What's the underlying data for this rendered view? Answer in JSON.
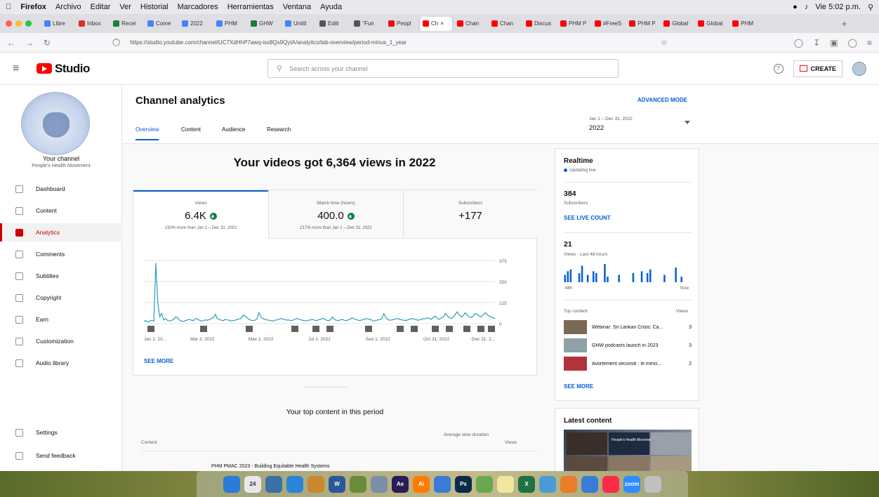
{
  "menubar": {
    "app": "Firefox",
    "items": [
      "Archivo",
      "Editar",
      "Ver",
      "Historial",
      "Marcadores",
      "Herramientas",
      "Ventana",
      "Ayuda"
    ],
    "clock": "Vie 5:02 p.m."
  },
  "browser": {
    "tabs": [
      {
        "label": "Libre",
        "color": "#4285f4"
      },
      {
        "label": "Inbox",
        "color": "#d93025"
      },
      {
        "label": "Recei",
        "color": "#188038"
      },
      {
        "label": "Come",
        "color": "#4285f4"
      },
      {
        "label": "2022",
        "color": "#4285f4"
      },
      {
        "label": "PHM",
        "color": "#4285f4"
      },
      {
        "label": "GHW",
        "color": "#188038"
      },
      {
        "label": "Untitl",
        "color": "#4285f4"
      },
      {
        "label": "Editi",
        "color": "#555555"
      },
      {
        "label": "\"Fun",
        "color": "#555555"
      },
      {
        "label": "Peopl",
        "color": "#ff0000"
      },
      {
        "label": "Ch",
        "color": "#ff0000",
        "active": true
      },
      {
        "label": "Chan",
        "color": "#ff0000"
      },
      {
        "label": "Chan",
        "color": "#ff0000"
      },
      {
        "label": "Discus",
        "color": "#ff0000"
      },
      {
        "label": "PHM P",
        "color": "#ff0000"
      },
      {
        "label": "#FreeS",
        "color": "#ff0000"
      },
      {
        "label": "PHM P",
        "color": "#ff0000"
      },
      {
        "label": "Global",
        "color": "#ff0000"
      },
      {
        "label": "Global",
        "color": "#ff0000"
      },
      {
        "label": "PHM",
        "color": "#ff0000"
      }
    ],
    "url": "https://studio.youtube.com/channel/UC7XdHhP7awq-isx8Qs9QytA/analytics/tab-overview/period-minus_1_year"
  },
  "studio": {
    "logo": "Studio",
    "search_placeholder": "Search across your channel",
    "create_label": "CREATE",
    "help_label": "?"
  },
  "sidebar": {
    "your_channel": "Your channel",
    "channel_name": "People's Health Movement",
    "items": [
      {
        "label": "Dashboard"
      },
      {
        "label": "Content"
      },
      {
        "label": "Analytics",
        "active": true
      },
      {
        "label": "Comments"
      },
      {
        "label": "Subtitles"
      },
      {
        "label": "Copyright"
      },
      {
        "label": "Earn"
      },
      {
        "label": "Customization"
      },
      {
        "label": "Audio library"
      }
    ],
    "bottom": [
      {
        "label": "Settings"
      },
      {
        "label": "Send feedback"
      }
    ]
  },
  "header": {
    "title": "Channel analytics",
    "advanced_mode": "ADVANCED MODE",
    "date_range": "Jan 1 – Dec 31, 2022",
    "date_year": "2022",
    "tabs": [
      "Overview",
      "Content",
      "Audience",
      "Research"
    ]
  },
  "overview": {
    "headline": "Your videos got 6,364 views in 2022",
    "metrics": [
      {
        "label": "Views",
        "value": "6.4K",
        "sub": "150% more than Jan 1 – Dec 31, 2021",
        "up": true
      },
      {
        "label": "Watch time (hours)",
        "value": "400.0",
        "sub": "217% more than Jan 1 – Dec 31, 2021",
        "up": true
      },
      {
        "label": "Subscribers",
        "value": "+177",
        "sub": "",
        "up": false
      }
    ],
    "see_more": "SEE MORE",
    "top_content_title": "Your top content in this period",
    "top_content_cols": {
      "content": "Content",
      "avg": "Average view duration",
      "views": "Views"
    },
    "top_content_first": "PHM PMAC 2023 - Building Equitable Health Systems"
  },
  "chart_data": {
    "type": "line",
    "x_ticks": [
      "Jan 1, 20...",
      "Mar 3, 2022",
      "May 2, 2022",
      "Jul 2, 2022",
      "Sep 1, 2022",
      "Oct 31, 2022",
      "Dec 31, 2..."
    ],
    "y_ticks": [
      "375",
      "250",
      "125",
      "0"
    ],
    "ylim": [
      0,
      375
    ],
    "color": "#2a9cbf",
    "series": [
      {
        "values": [
          12,
          18,
          10,
          15,
          20,
          14,
          360,
          120,
          40,
          60,
          22,
          30,
          18,
          15,
          20,
          25,
          40,
          35,
          20,
          15,
          12,
          18,
          22,
          25,
          20,
          18,
          30,
          28,
          20,
          15,
          18,
          22,
          20,
          24,
          30,
          35,
          55,
          30,
          25,
          20,
          18,
          25,
          22,
          20,
          15,
          18,
          20,
          25,
          28,
          30,
          50,
          45,
          35,
          25,
          20,
          18,
          20,
          28,
          65,
          40,
          30,
          25,
          22,
          20,
          18,
          15,
          20,
          22,
          25,
          30,
          28,
          25,
          20,
          22,
          18,
          20,
          25,
          30,
          28,
          22,
          20,
          18,
          15,
          20,
          22,
          25,
          20,
          18,
          22,
          25,
          30,
          28,
          20,
          18,
          22,
          40,
          25,
          20,
          18,
          22,
          25,
          20,
          18,
          22,
          25,
          35,
          28,
          25,
          20,
          18,
          22,
          25,
          30,
          28,
          25,
          20,
          15,
          18,
          22,
          25,
          30,
          60,
          35,
          25,
          20,
          22,
          25,
          28,
          30,
          25,
          22,
          20,
          18,
          22,
          25,
          30,
          28,
          25,
          20,
          22,
          25,
          30,
          28,
          35,
          30,
          25,
          40,
          45,
          30,
          25,
          35,
          40,
          60,
          45,
          35,
          30,
          40,
          55,
          70,
          50,
          40,
          45,
          65,
          50,
          40,
          35,
          45,
          60,
          55,
          45,
          40,
          50,
          65,
          55,
          45,
          40,
          35,
          30
        ]
      }
    ],
    "markers": [
      "04",
      "",
      "",
      "",
      "",
      "04",
      "",
      "",
      "",
      "",
      "",
      "",
      "",
      "",
      ""
    ]
  },
  "realtime": {
    "title": "Realtime",
    "live": "Updating live",
    "subs_value": "384",
    "subs_label": "Subscribers",
    "see_live": "SEE LIVE COUNT",
    "views_value": "21",
    "views_label": "Views · Last 48 hours",
    "axis_left": "-48h",
    "axis_right": "Now",
    "bars": [
      0.4,
      0.6,
      0.7,
      0,
      0,
      0.5,
      0.9,
      0,
      0.4,
      0,
      0.6,
      0.5,
      0,
      0,
      1,
      0.3,
      0,
      0,
      0,
      0.4,
      0,
      0,
      0,
      0,
      0.5,
      0,
      0,
      0.6,
      0,
      0.5,
      0.7,
      0,
      0,
      0,
      0,
      0.4,
      0,
      0,
      0,
      0.8,
      0,
      0.3
    ],
    "bar_color": "#065fd4",
    "top_content_label": "Top content",
    "views_col": "Views",
    "top_content": [
      {
        "title": "Webinar: Sri Lankan Crisis: Ca...",
        "views": "3",
        "color": "#7a6a55"
      },
      {
        "title": "GHW podcasts launch in 2023",
        "views": "3",
        "color": "#8fa1a9"
      },
      {
        "title": "Avortement sécurisé : le mess...",
        "views": "2",
        "color": "#b2343b"
      }
    ],
    "see_more": "SEE MORE"
  },
  "latest": {
    "title": "Latest content",
    "thumb_caption": "People's Health Movement S..."
  },
  "dock": {
    "apps": [
      {
        "label": "",
        "color": "#2b7bd8"
      },
      {
        "label": "24",
        "color": "#e8e8e8"
      },
      {
        "label": "",
        "color": "#3b6fa8"
      },
      {
        "label": "",
        "color": "#2a84d8"
      },
      {
        "label": "",
        "color": "#c8882d"
      },
      {
        "label": "W",
        "color": "#2b5797"
      },
      {
        "label": "",
        "color": "#6a8c3a"
      },
      {
        "label": "",
        "color": "#7b8fa8"
      },
      {
        "label": "Ae",
        "color": "#2a1b55"
      },
      {
        "label": "Ai",
        "color": "#ff7c00"
      },
      {
        "label": "",
        "color": "#3a7bd5"
      },
      {
        "label": "Ps",
        "color": "#0a2a4a"
      },
      {
        "label": "",
        "color": "#6aa84f"
      },
      {
        "label": "",
        "color": "#f0e6a0"
      },
      {
        "label": "X",
        "color": "#1e7145"
      },
      {
        "label": "",
        "color": "#4a9ad8"
      },
      {
        "label": "",
        "color": "#e87d2a"
      },
      {
        "label": "",
        "color": "#3a7bd5"
      },
      {
        "label": "",
        "color": "#fa2d48"
      },
      {
        "label": "zoom",
        "color": "#2d8cff"
      },
      {
        "label": "",
        "color": "#c0c0c0"
      }
    ]
  }
}
